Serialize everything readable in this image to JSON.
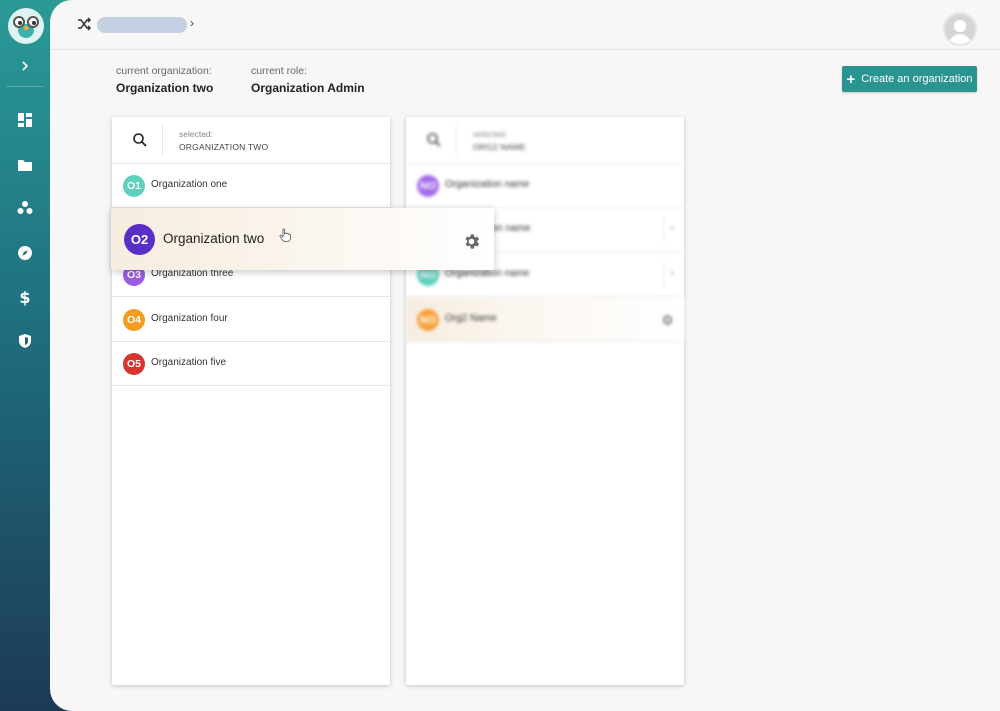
{
  "sidebar": {
    "expand_icon": "chevron-right-icon",
    "nav": [
      {
        "name": "dashboard-icon"
      },
      {
        "name": "folder-icon"
      },
      {
        "name": "groups-icon"
      },
      {
        "name": "compass-icon"
      },
      {
        "name": "dollar-icon",
        "glyph": "$"
      },
      {
        "name": "shield-icon"
      }
    ]
  },
  "header": {
    "shuffle_icon": "shuffle-icon",
    "breadcrumb_chevron": "›"
  },
  "context": {
    "org_label": "current organization:",
    "org_value": "Organization two",
    "role_label": "current role:",
    "role_value": "Organization Admin"
  },
  "actions": {
    "create_plus": "+",
    "create_label": "Create an organization",
    "accent": "#2a9590"
  },
  "left_panel": {
    "selected_label": "selected:",
    "selected_value": "ORGANIZATION TWO",
    "rows": [
      {
        "badge": "O1",
        "label": "Organization one",
        "color": "#5fcfbe"
      },
      {
        "badge": "O3",
        "label": "Organization three",
        "color": "#9b5de5"
      },
      {
        "badge": "O4",
        "label": "Organization four",
        "color": "#f39c1f"
      },
      {
        "badge": "O5",
        "label": "Organization five",
        "color": "#d9352f"
      }
    ]
  },
  "drag_card": {
    "badge": "O2",
    "label": "Organization two",
    "color": "#5a2fc8"
  },
  "right_panel": {
    "selected_label": "selected:",
    "selected_value": "ORG2 NAME",
    "rows": [
      {
        "badge": "NO",
        "label": "Organization name",
        "color": "#a56be8"
      },
      {
        "badge": "",
        "label": "ation name",
        "color": "#ffffff"
      },
      {
        "badge": "NO",
        "label": "Organization name",
        "color": "#5fcfbe"
      },
      {
        "badge": "NO",
        "label": "Org2 Name",
        "color": "#f6a23a"
      }
    ],
    "chevron": "›"
  }
}
